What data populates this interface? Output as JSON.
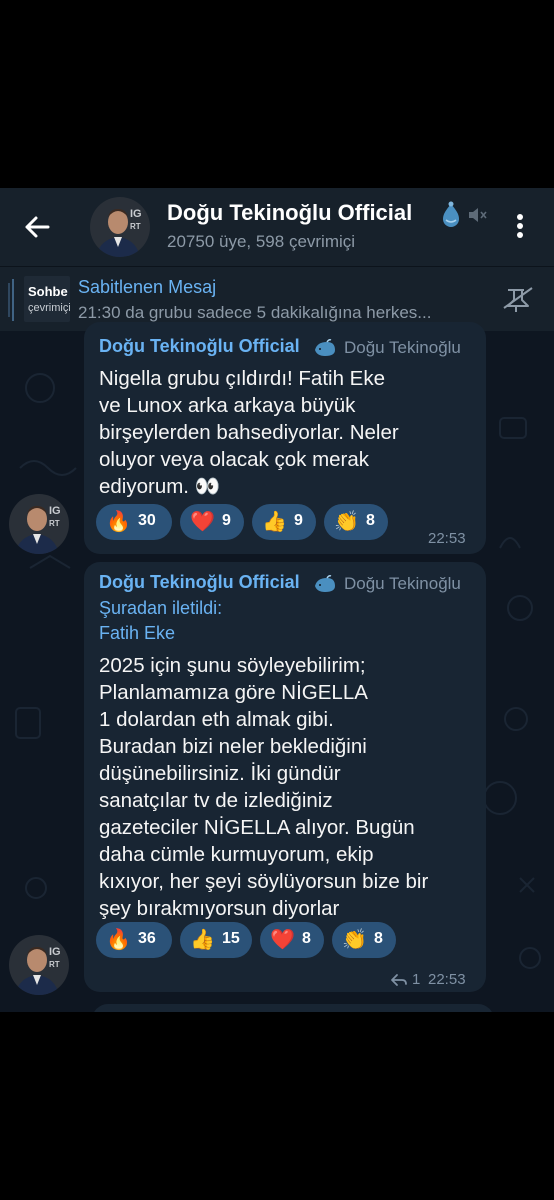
{
  "header": {
    "title": "Doğu Tekinoğlu Official",
    "subtitle": "20750 üye, 598 çevrimiçi"
  },
  "pinned": {
    "title": "Sabitlenen Mesaj",
    "text": "21:30 da grubu sadece 5 dakikalığına herkes...",
    "thumb_text": "Sohbe",
    "thumb_text2": "çevrimiçi"
  },
  "messages": [
    {
      "sender": "Doğu Tekinoğlu Official",
      "author": "Doğu Tekinoğlu",
      "lines": [
        "Nigella grubu çıldırdı! Fatih Eke",
        "ve Lunox arka arkaya büyük",
        "birşeylerden bahsediyorlar. Neler",
        "oluyor veya olacak çok merak",
        "ediyorum. 👀"
      ],
      "reactions": [
        {
          "emoji": "🔥",
          "count": "30"
        },
        {
          "emoji": "❤️",
          "count": "9"
        },
        {
          "emoji": "👍",
          "count": "9"
        },
        {
          "emoji": "👏",
          "count": "8"
        }
      ],
      "time": "22:53"
    },
    {
      "sender": "Doğu Tekinoğlu Official",
      "author": "Doğu Tekinoğlu",
      "forwarded_label": "Şuradan iletildi:",
      "forwarded_from": "Fatih Eke",
      "lines": [
        "2025 için şunu söyleyebilirim;",
        "Planlamamıza göre NİGELLA",
        "1 dolardan eth almak gibi.",
        "Buradan bizi neler beklediğini",
        "düşünebilirsiniz. İki gündür",
        "sanatçılar tv de izlediğiniz",
        "gazeteciler NİGELLA alıyor. Bugün",
        "daha cümle kurmuyorum, ekip",
        "kıxıyor, her şeyi söylüyorsun bize bir",
        "şey bırakmıyorsun diyorlar"
      ],
      "reactions": [
        {
          "emoji": "🔥",
          "count": "36"
        },
        {
          "emoji": "👍",
          "count": "15"
        },
        {
          "emoji": "❤️",
          "count": "8"
        },
        {
          "emoji": "👏",
          "count": "8"
        }
      ],
      "replies": "1",
      "time": "22:53"
    }
  ],
  "colors": {
    "header_bg": "#17212b",
    "chat_bg": "#0e1621",
    "bubble_bg": "#182533",
    "accent": "#6ab3f3",
    "reaction_bg": "#2b5278"
  },
  "icons": [
    "back-arrow-icon",
    "verified-icon",
    "mute-icon",
    "menu-dots-icon",
    "unpin-icon",
    "whale-icon",
    "reply-icon"
  ]
}
